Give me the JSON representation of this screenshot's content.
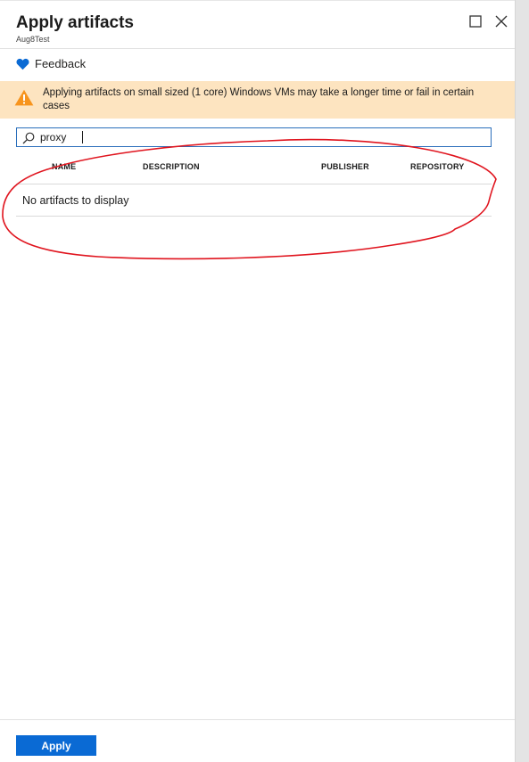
{
  "blade": {
    "title": "Apply artifacts",
    "subtitle": "Aug8Test"
  },
  "window_controls": {
    "maximize_icon": "maximize-icon",
    "close_icon": "close-icon"
  },
  "feedback": {
    "label": "Feedback",
    "icon": "heart-icon",
    "color": "#0a6ad4"
  },
  "warning": {
    "icon": "warning-triangle-icon",
    "text": "Applying artifacts on small sized (1 core) Windows VMs may take a longer time or fail in certain cases",
    "background": "#fde4c0",
    "icon_color": "#f7941d"
  },
  "search": {
    "value": "proxy",
    "placeholder": "",
    "icon": "search-icon"
  },
  "table": {
    "columns": [
      "NAME",
      "DESCRIPTION",
      "PUBLISHER",
      "REPOSITORY"
    ],
    "empty_message": "No artifacts to display"
  },
  "footer": {
    "apply_label": "Apply",
    "accent": "#0a6ad4"
  },
  "annotation": {
    "color": "#e0141e"
  }
}
